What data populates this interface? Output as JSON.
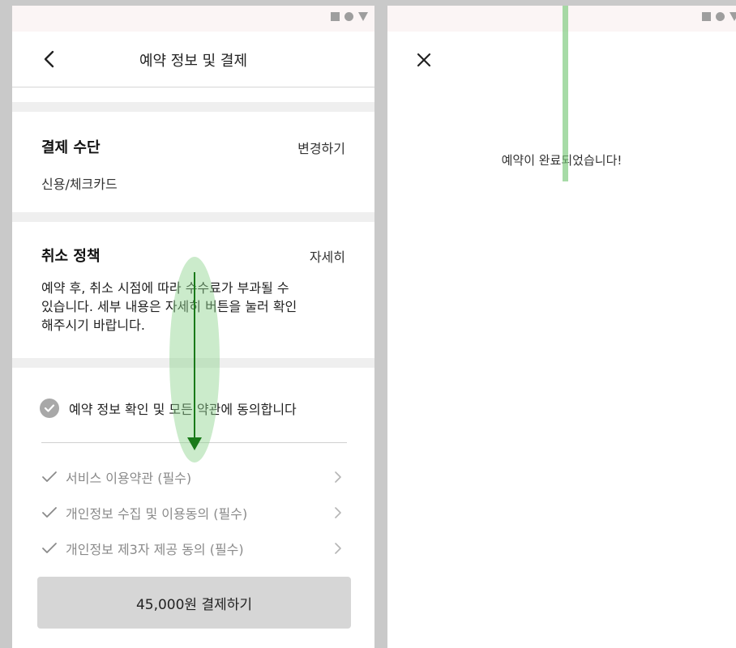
{
  "left_screen": {
    "header": {
      "title": "예약 정보 및 결제",
      "back_icon": "chevron-left-icon"
    },
    "payment_method": {
      "title": "결제 수단",
      "change_label": "변경하기",
      "value": "신용/체크카드"
    },
    "cancel_policy": {
      "title": "취소 정책",
      "detail_label": "자세히",
      "lines": [
        "예약 후, 취소 시점에 따라 수수료가 부과될 수",
        "있습니다. 세부 내용은 자세히 버튼을 눌러 확인",
        "해주시기 바랍니다."
      ]
    },
    "agreement": {
      "all_label": "예약 정보 확인 및 모든 약관에 동의합니다",
      "terms": [
        {
          "label": "서비스 이용약관 (필수)"
        },
        {
          "label": "개인정보 수집 및 이용동의 (필수)"
        },
        {
          "label": "개인정보 제3자 제공 동의 (필수)"
        }
      ]
    },
    "pay_button_label": "45,000원 결제하기"
  },
  "right_screen": {
    "close_icon": "close-icon",
    "message": "예약이 완료되었습니다!"
  },
  "colors": {
    "button_bg": "#d6d6d6",
    "check_bg": "#a8a8a8",
    "swipe_arrow": "#1a7a1a",
    "highlight": "#78c878"
  },
  "overlays": {
    "swipe_direction": "down"
  }
}
